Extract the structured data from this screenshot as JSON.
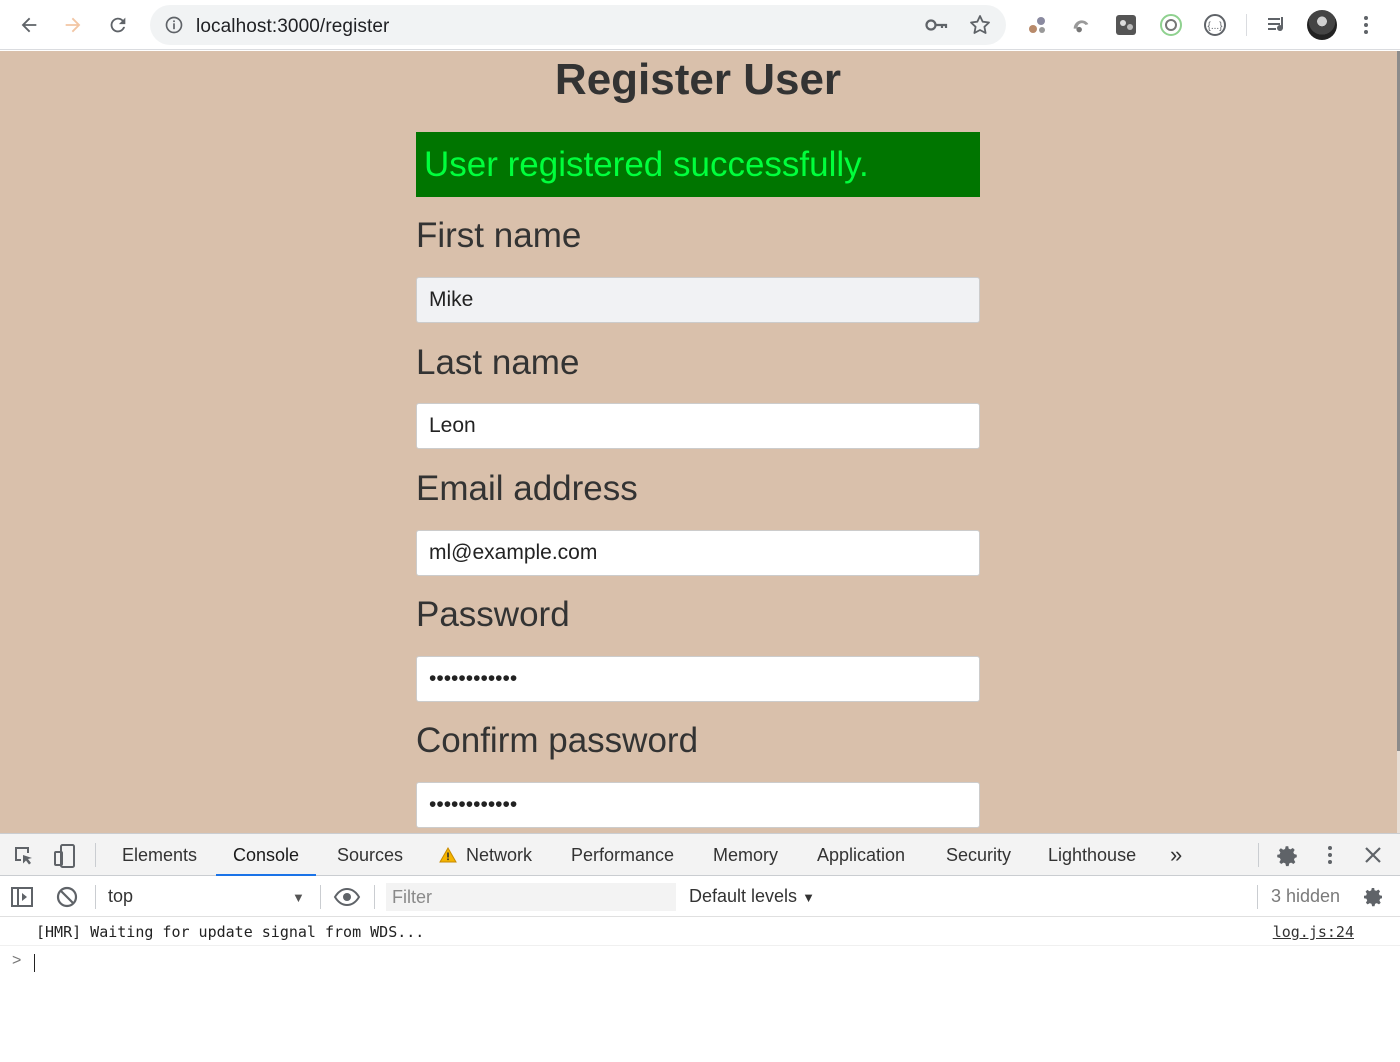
{
  "browser": {
    "url": "localhost:3000/register"
  },
  "page": {
    "title": "Register User",
    "success_message": "User registered successfully.",
    "fields": [
      {
        "label": "First name",
        "value": "Mike",
        "type": "text"
      },
      {
        "label": "Last name",
        "value": "Leon",
        "type": "text"
      },
      {
        "label": "Email address",
        "value": "ml@example.com",
        "type": "email"
      },
      {
        "label": "Password",
        "value": "123456789012",
        "type": "password"
      },
      {
        "label": "Confirm password",
        "value": "123456789012",
        "type": "password"
      }
    ],
    "colors": {
      "background": "#d9c0ab",
      "success_bg": "#007500",
      "success_text": "#00ff3c"
    }
  },
  "devtools": {
    "tabs": [
      "Elements",
      "Console",
      "Sources",
      "Network",
      "Performance",
      "Memory",
      "Application",
      "Security",
      "Lighthouse"
    ],
    "active_tab": "Console",
    "more_tabs": "»",
    "context": "top",
    "filter_placeholder": "Filter",
    "levels": "Default levels",
    "hidden_count": "3 hidden",
    "log": {
      "message": "[HMR] Waiting for update signal from WDS...",
      "source": "log.js:24"
    },
    "prompt": ">"
  }
}
